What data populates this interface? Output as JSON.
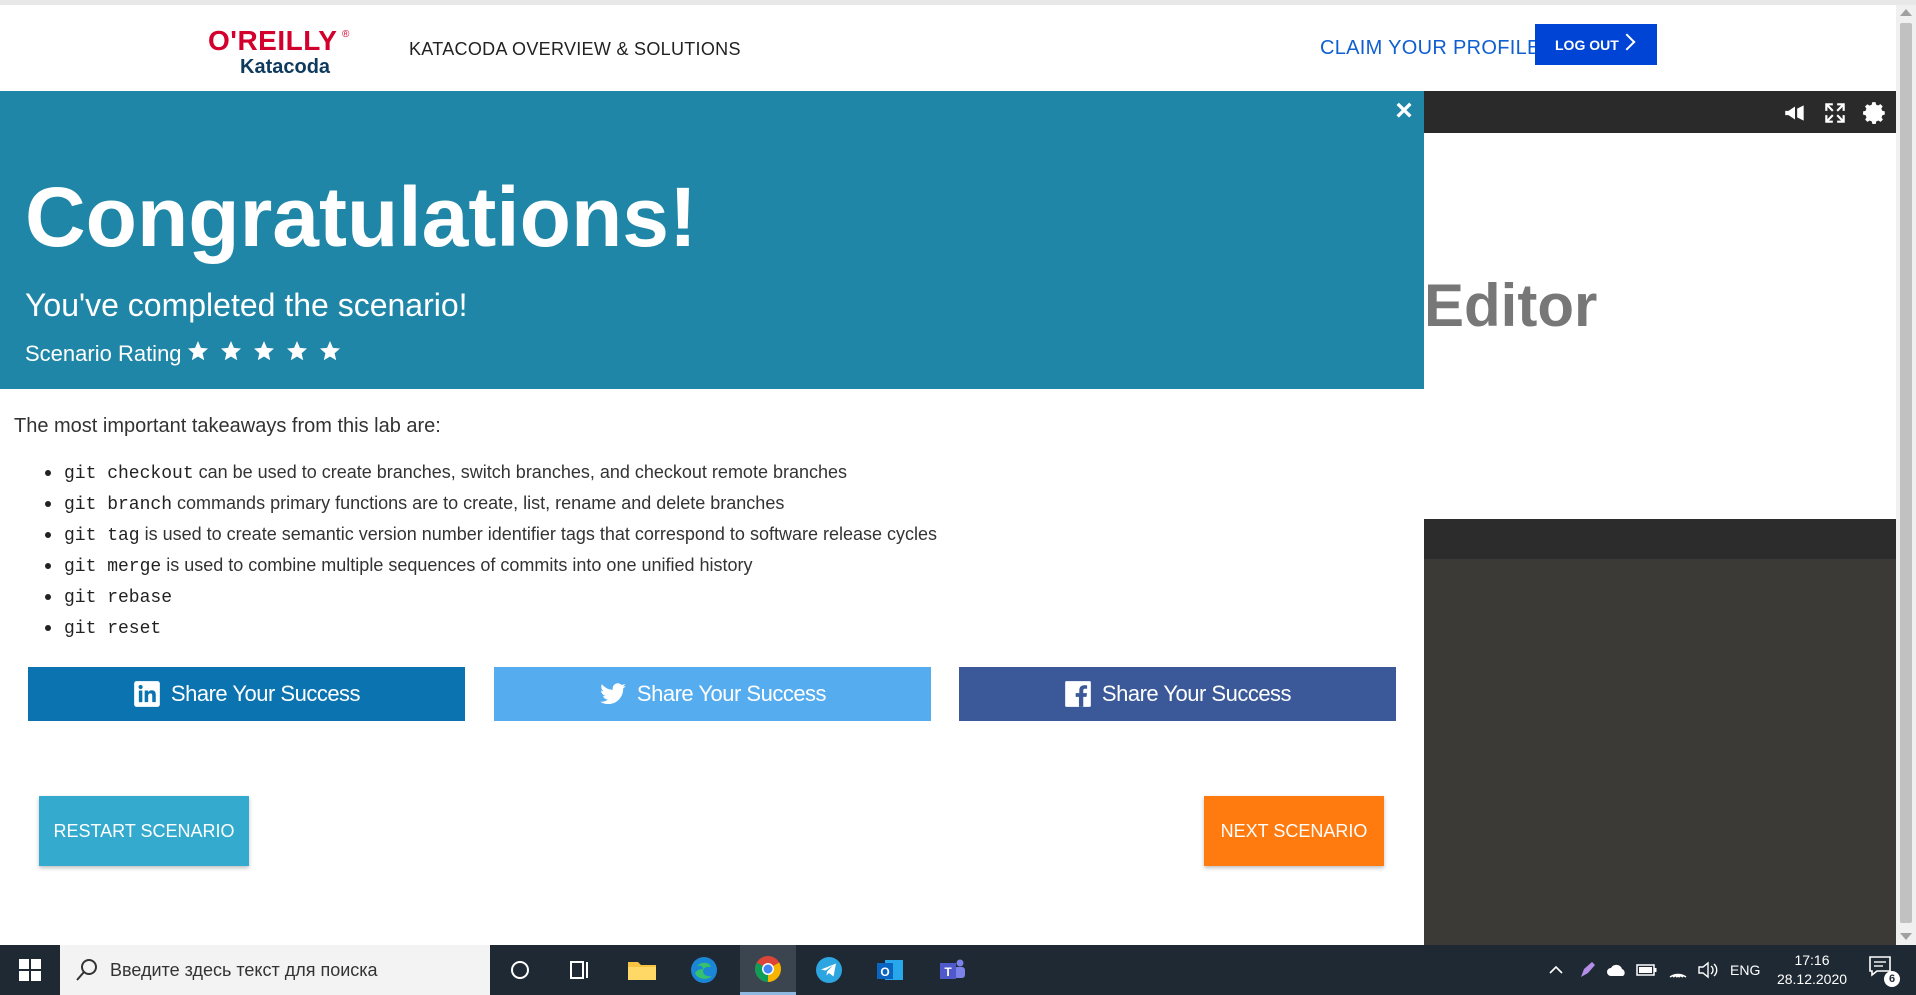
{
  "header": {
    "logo_top": "O'REILLY",
    "logo_bottom": "Katacoda",
    "nav_overview": "KATACODA OVERVIEW & SOLUTIONS",
    "claim_profile": "CLAIM YOUR PROFILE",
    "logout": "LOG OUT"
  },
  "background_panel": {
    "editor_text": "Editor",
    "toolbar_icons": [
      "megaphone-icon",
      "fullscreen-icon",
      "gear-icon"
    ]
  },
  "modal": {
    "title": "Congratulations!",
    "subtitle": "You've completed the scenario!",
    "rating_label": "Scenario Rating",
    "rating_stars": 5,
    "takeaways_title": "The most important takeaways from this lab are:",
    "takeaways": [
      {
        "code": "git checkout",
        "text": " can be used to create branches, switch branches, and checkout remote branches"
      },
      {
        "code": "git branch",
        "text": " commands primary functions are to create, list, rename and delete branches"
      },
      {
        "code": "git tag",
        "text": " is used to create semantic version number identifier tags that correspond to software release cycles"
      },
      {
        "code": "git merge",
        "text": " is used to combine multiple sequences of commits into one unified history"
      },
      {
        "code": "git rebase",
        "text": ""
      },
      {
        "code": "git reset",
        "text": ""
      }
    ],
    "share_linkedin": "Share Your Success",
    "share_twitter": "Share Your Success",
    "share_facebook": "Share Your Success",
    "restart": "RESTART SCENARIO",
    "next": "NEXT SCENARIO"
  },
  "colors": {
    "modal_header": "#1f86a8",
    "linkedin": "#0a73b0",
    "twitter": "#55acee",
    "facebook": "#3b5998",
    "restart": "#33aace",
    "next": "#ff7a0f",
    "logout": "#0044d6"
  },
  "taskbar": {
    "search_placeholder": "Введите здесь текст для поиска",
    "apps": [
      "cortana-icon",
      "task-view-icon",
      "file-explorer-icon",
      "edge-icon",
      "chrome-icon",
      "telegram-icon",
      "outlook-icon",
      "teams-icon"
    ],
    "language": "ENG",
    "time": "17:16",
    "date": "28.12.2020",
    "notifications": "6"
  }
}
